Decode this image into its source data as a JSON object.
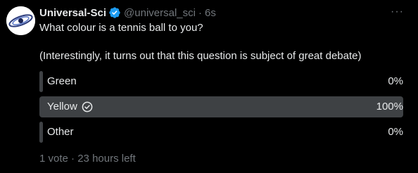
{
  "tweet": {
    "author_name": "Universal-Sci",
    "handle": "@universal_sci",
    "separator": "·",
    "time": "6s",
    "text_line1": "What colour is a tennis ball to you?",
    "text_line2": "(Interestingly, it turns out that this question is subject of great debate)"
  },
  "poll": {
    "options": [
      {
        "label": "Green",
        "percent": "0%",
        "share": 0
      },
      {
        "label": "Yellow",
        "percent": "100%",
        "share": 1,
        "selected": true
      },
      {
        "label": "Other",
        "percent": "0%",
        "share": 0
      }
    ],
    "votes": "1 vote",
    "separator": "·",
    "time_left": "23 hours left"
  },
  "colors": {
    "background": "#000000",
    "text": "#e7e9ea",
    "muted": "#71767b",
    "bar": "#3e4144",
    "verified": "#1d9bf0"
  },
  "icons": {
    "verified": "verified-badge-icon",
    "more": "more-options-icon",
    "selected": "check-circle-icon"
  }
}
